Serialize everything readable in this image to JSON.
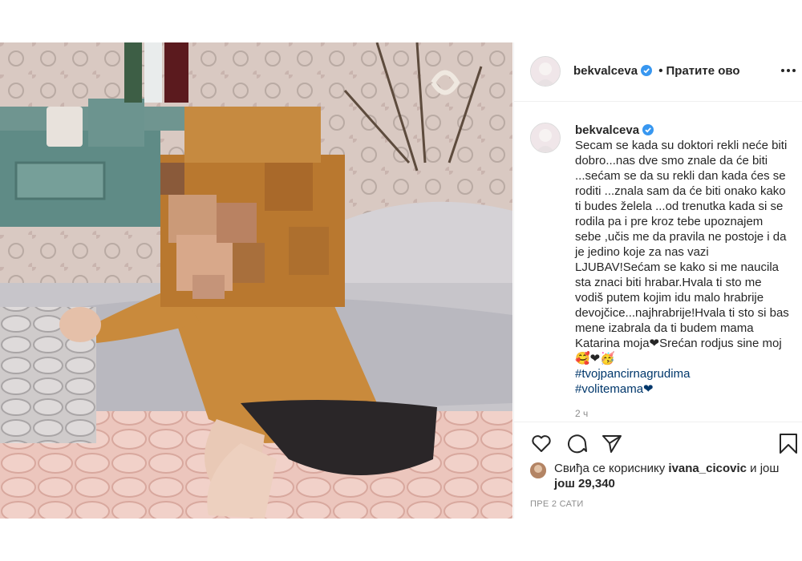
{
  "post": {
    "image_alt": "Child in mustard hoodie sitting on bed (face pixelated)"
  },
  "header": {
    "username": "bekvalceva",
    "separator": "•",
    "follow_label": "Пратите ово"
  },
  "caption": {
    "username": "bekvalceva",
    "text": "Secam se kada su doktori rekli neće biti dobro...nas dve smo znale da će biti ...sećam se da su rekli dan kada ćes se roditi ...znala sam da će biti onako kako ti budes želela ...od trenutka kada si se rodila pa i pre kroz tebe upoznajem sebe ,učis me da pravila ne postoje i da je jedino koje za nas vazi LJUBAV!Sećam se kako si me naucila sta znaci biti hrabar.Hvala ti sto me vodiš putem kojim idu malo hrabrije devojčice...najhrabrije!Hvala ti sto si bas mene izabrala da ti budem mama Katarina moja❤Srećan rodjus sine moj🥰❤🥳",
    "hashtags": [
      "#tvojpancirnagrudima",
      "#volitemama❤"
    ],
    "age": "2 ч"
  },
  "likes": {
    "prefix": "Свиђа се кориснику",
    "user": "ivana_cicovic",
    "middle": "и још",
    "count_text": "још 29,340"
  },
  "timestamp": "ПРЕ 2 САТИ",
  "icons": {
    "like": "heart-icon",
    "comment": "comment-icon",
    "share": "paper-plane-icon",
    "save": "bookmark-icon",
    "more": "ellipsis-icon",
    "verified": "verified-badge-icon"
  },
  "colors": {
    "verified": "#3897f0",
    "hashtag": "#00376b",
    "muted": "#8e8e8e",
    "border": "#efefef"
  }
}
